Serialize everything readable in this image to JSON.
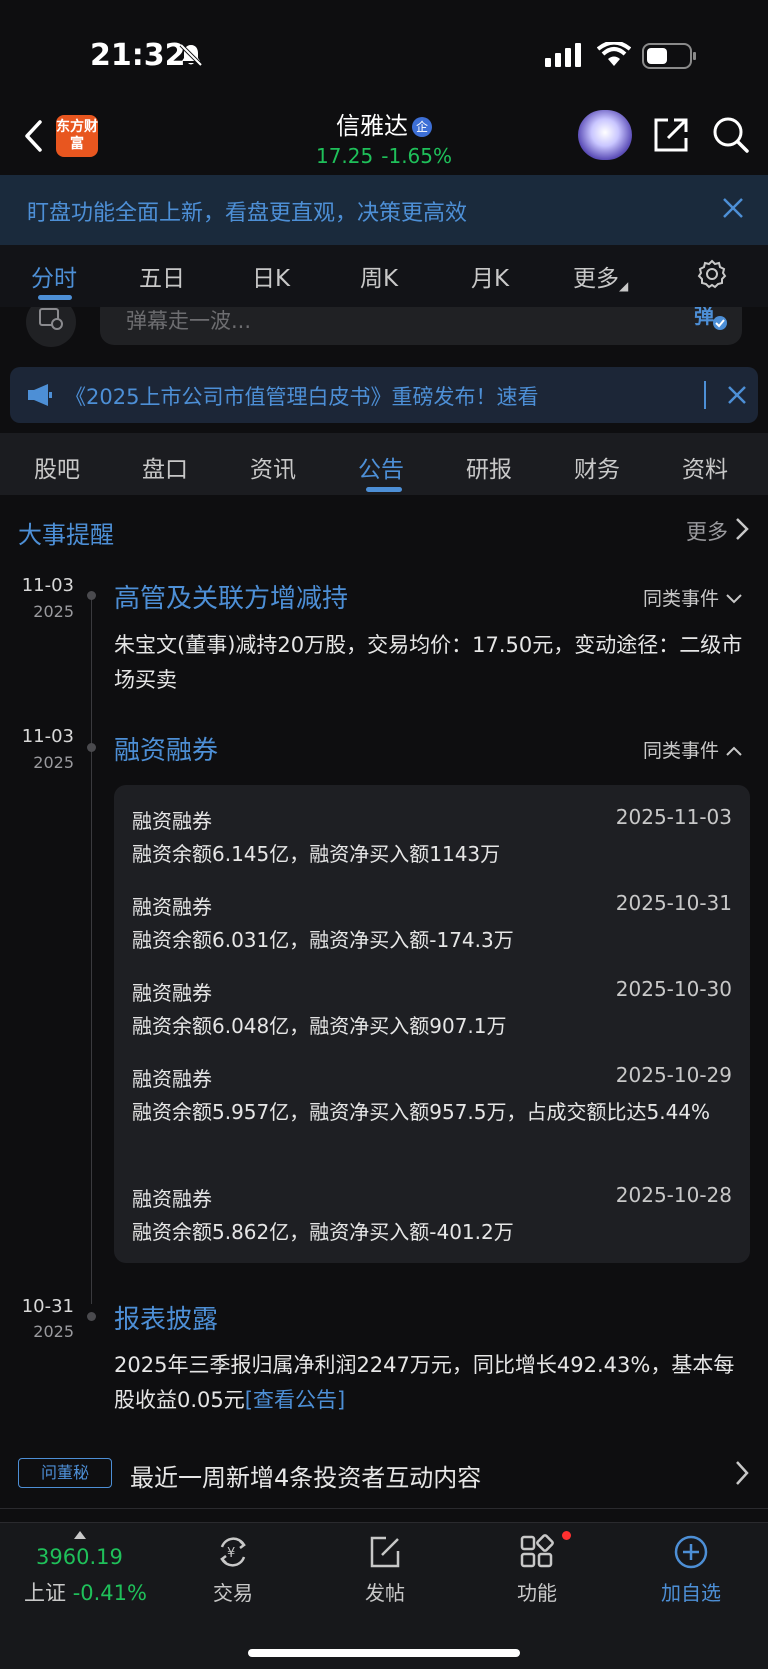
{
  "status_bar": {
    "time": "21:32"
  },
  "header": {
    "logo_text": "东方财富",
    "stock_name": "信雅达",
    "badge": "企",
    "price": "17.25",
    "change_pct": "-1.65%"
  },
  "banner": {
    "text": "盯盘功能全面上新，看盘更直观，决策更高效"
  },
  "chart_tabs": [
    "分时",
    "五日",
    "日K",
    "周K",
    "月K",
    "更多"
  ],
  "danmu": {
    "placeholder": "弹幕走一波..."
  },
  "notice": {
    "text": "《2025上市公司市值管理白皮书》重磅发布！速看"
  },
  "info_tabs": [
    "股吧",
    "盘口",
    "资讯",
    "公告",
    "研报",
    "财务",
    "资料"
  ],
  "events_section": {
    "title": "大事提醒",
    "more_label": "更多"
  },
  "events": [
    {
      "date": "11-03",
      "year": "2025",
      "title": "高管及关联方增减持",
      "similar_label": "同类事件",
      "body": "朱宝文(董事)减持20万股，交易均价：17.50元，变动途径：二级市场买卖"
    },
    {
      "date": "11-03",
      "year": "2025",
      "title": "融资融券",
      "similar_label": "同类事件",
      "items": [
        {
          "title": "融资融券",
          "date": "2025-11-03",
          "body": "融资余额6.145亿，融资净买入额1143万"
        },
        {
          "title": "融资融券",
          "date": "2025-10-31",
          "body": "融资余额6.031亿，融资净买入额-174.3万"
        },
        {
          "title": "融资融券",
          "date": "2025-10-30",
          "body": "融资余额6.048亿，融资净买入额907.1万"
        },
        {
          "title": "融资融券",
          "date": "2025-10-29",
          "body": "融资余额5.957亿，融资净买入额957.5万，占成交额比达5.44%"
        },
        {
          "title": "融资融券",
          "date": "2025-10-28",
          "body": "融资余额5.862亿，融资净买入额-401.2万"
        }
      ]
    },
    {
      "date": "10-31",
      "year": "2025",
      "title": "报表披露",
      "body": "2025年三季报归属净利润2247万元，同比增长492.43%，基本每股收益0.05元",
      "link": "[查看公告]"
    }
  ],
  "qa": {
    "tag": "问董秘",
    "text": "最近一周新增4条投资者互动内容"
  },
  "bottom_bar": {
    "index_value": "3960.19",
    "index_name": "上证",
    "index_change": "-0.41%",
    "items": [
      "交易",
      "发帖",
      "功能",
      "加自选"
    ]
  },
  "colors": {
    "accent": "#4d8fd6",
    "down_green": "#1fc05a",
    "background": "#0e0e10"
  }
}
